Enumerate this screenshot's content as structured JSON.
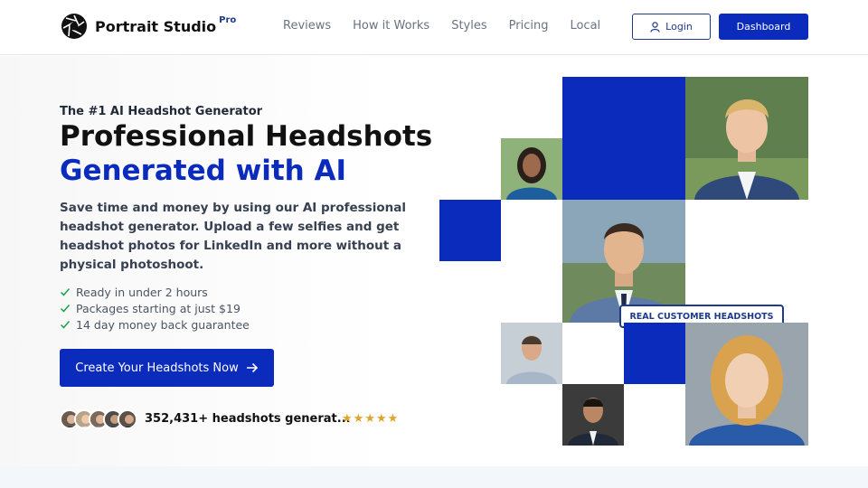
{
  "header": {
    "brand": "Portrait Studio",
    "brand_badge": "Pro",
    "nav": [
      "Reviews",
      "How it Works",
      "Styles",
      "Pricing",
      "Local"
    ],
    "login_label": "Login",
    "dashboard_label": "Dashboard"
  },
  "hero": {
    "eyebrow": "The #1 AI Headshot Generator",
    "title_line1": "Professional Headshots",
    "title_line2": "Generated with AI",
    "lead": "Save time and money by using our AI professional headshot generator. Upload a few selfies and get headshot photos for LinkedIn and more without a physical photoshoot.",
    "checks": [
      "Ready in under 2 hours",
      "Packages starting at just $19",
      "14 day money back guarantee"
    ],
    "cta_label": "Create Your Headshots Now",
    "social_proof": "352,431+ headshots generat...",
    "rating_stars": 5
  },
  "collage": {
    "badge": "REAL CUSTOMER HEADSHOTS"
  },
  "colors": {
    "brand_blue": "#0b2bbd",
    "navy": "#1e3a8a",
    "star": "#e0a526",
    "check": "#16a34a"
  },
  "icons": {
    "logo": "aperture-icon",
    "login": "user-icon",
    "cta": "arrow-right-icon",
    "check": "check-icon",
    "star": "star-icon"
  }
}
